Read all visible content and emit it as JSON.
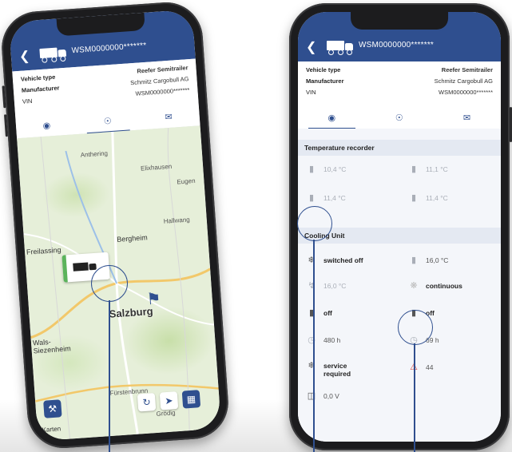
{
  "left_phone": {
    "header": {
      "vin": "WSM0000000*******"
    },
    "info": {
      "vehicle_type_label": "Vehicle type",
      "vehicle_type_value": "Reefer Semitrailer",
      "manufacturer_label": "Manufacturer",
      "manufacturer_value": "Schmitz Cargobull AG",
      "vin_label": "VIN",
      "vin_value": "WSM0000000*******"
    },
    "map": {
      "labels": [
        "Anthering",
        "Eugen",
        "Freilassing",
        "Bergheim",
        "Salzburg",
        "Wals-Siezenheim",
        "Grödig",
        "Karten",
        "Hallwang",
        "Elixhausen",
        "Fürstenbrunn"
      ],
      "city": "Salzburg"
    }
  },
  "right_phone": {
    "header": {
      "vin": "WSM0000000*******"
    },
    "info": {
      "vehicle_type_label": "Vehicle type",
      "vehicle_type_value": "Reefer Semitrailer",
      "manufacturer_label": "Manufacturer",
      "manufacturer_value": "Schmitz Cargobull AG",
      "vin_label": "VIN",
      "vin_value": "WSM0000000*******"
    },
    "temperature_recorder": {
      "title": "Temperature recorder",
      "values": [
        "10,4 °C",
        "11,1 °C",
        "11,4 °C",
        "11,4 °C"
      ]
    },
    "cooling_unit": {
      "title": "Cooling Unit",
      "rows": [
        {
          "left": "switched off",
          "right": "16,0 °C"
        },
        {
          "left": "16,0 °C",
          "right": "continuous"
        },
        {
          "left": "off",
          "right": "off"
        },
        {
          "left": "480 h",
          "right": "69 h"
        },
        {
          "left": "service required",
          "right": "44"
        }
      ],
      "voltage": "0,0 V"
    }
  },
  "colors": {
    "brand": "#2f4f8f",
    "accent_green": "#5bb35b",
    "alert_red": "#d9433a"
  }
}
